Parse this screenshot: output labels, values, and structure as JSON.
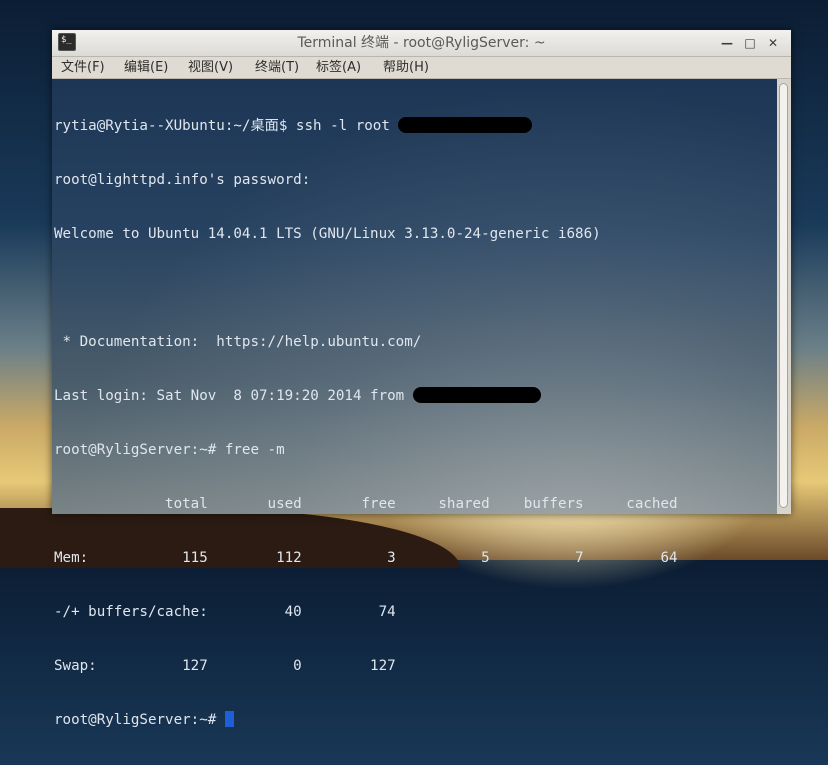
{
  "window": {
    "title": "Terminal 终端 - root@RyligServer: ~",
    "minimize_glyph": "—",
    "maximize_glyph": "□",
    "close_glyph": "✕",
    "app_icon_glyph": "$_"
  },
  "menu": {
    "file": "文件(F)",
    "edit": "编辑(E)",
    "view": "视图(V)",
    "terminal": "终端(T)",
    "tabs": "标签(A)",
    "help": "帮助(H)"
  },
  "terminal": {
    "line1_cmd": "rytia@Rytia--XUbuntu:~/桌面$ ssh -l root ",
    "line2": "root@lighttpd.info's password:",
    "line3": "Welcome to Ubuntu 14.04.1 LTS (GNU/Linux 3.13.0-24-generic i686)",
    "line4": "",
    "line5": " * Documentation:  https://help.ubuntu.com/",
    "line6_text": "Last login: Sat Nov  8 07:19:20 2014 from ",
    "line7": "root@RyligServer:~# free -m",
    "line8": "             total       used       free     shared    buffers     cached",
    "line9": "Mem:           115        112          3          5          7         64",
    "line10": "-/+ buffers/cache:         40         74",
    "line11": "Swap:          127          0        127",
    "line12_prompt": "root@RyligServer:~# "
  },
  "colors": {
    "terminal_text": "#dfe6ee",
    "cursor": "#1e5fd8"
  }
}
